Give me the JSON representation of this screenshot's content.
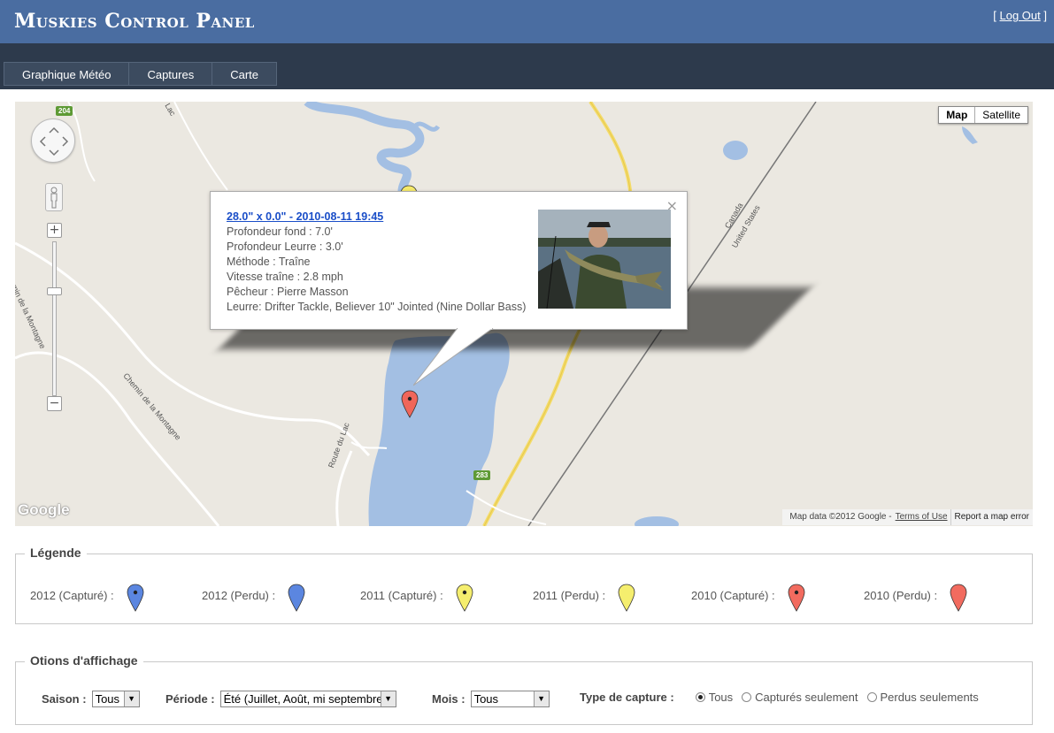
{
  "header": {
    "title": "Muskies Control Panel",
    "logout_prefix": "[ ",
    "logout_label": "Log Out",
    "logout_suffix": " ]"
  },
  "nav": {
    "tabs": [
      {
        "label": "Graphique Météo"
      },
      {
        "label": "Captures"
      },
      {
        "label": "Carte"
      }
    ]
  },
  "map": {
    "type_buttons": [
      "Map",
      "Satellite"
    ],
    "active_type": "Map",
    "logo": "Google",
    "footer": {
      "data_text": "Map data ©2012 Google -",
      "terms": "Terms of Use",
      "report": "Report a map error"
    },
    "road_shields": [
      "204",
      "283"
    ],
    "labels": {
      "chemin1": "Chemin de la Montagne",
      "chemin2": "Chemin de la Montagne",
      "route": "Route du Lac",
      "canada": "Canada",
      "us": "United States",
      "lac": "Lac"
    },
    "info_window": {
      "title": "28.0\" x 0.0\" - 2010-08-11 19:45",
      "lines": [
        "Profondeur fond : 7.0'",
        "Profondeur Leurre : 3.0'",
        "Méthode : Traîne",
        "Vitesse traîne : 2.8 mph",
        "Pêcheur : Pierre Masson",
        "Leurre: Drifter Tackle, Believer 10\" Jointed (Nine Dollar Bass)"
      ],
      "close": "×"
    },
    "markers": [
      {
        "year": "2011",
        "status": "Capturé",
        "color": "#f5e96a"
      },
      {
        "year": "2010",
        "status": "Capturé",
        "color": "#f0665a"
      }
    ]
  },
  "legend": {
    "title": "Légende",
    "items": [
      {
        "label": "2012 (Capturé) :",
        "color": "#5b86e0",
        "dot": true
      },
      {
        "label": "2012 (Perdu) :",
        "color": "#5b86e0",
        "dot": false
      },
      {
        "label": "2011 (Capturé) :",
        "color": "#f5ee6e",
        "dot": true
      },
      {
        "label": "2011 (Perdu) :",
        "color": "#f5ee6e",
        "dot": false
      },
      {
        "label": "2010 (Capturé) :",
        "color": "#f26b5f",
        "dot": true
      },
      {
        "label": "2010 (Perdu) :",
        "color": "#f26b5f",
        "dot": false
      }
    ]
  },
  "options": {
    "title": "Otions d'affichage",
    "saison": {
      "label": "Saison :",
      "value": "Tous"
    },
    "periode": {
      "label": "Période :",
      "value": "Été (Juillet, Août, mi septembre)"
    },
    "mois": {
      "label": "Mois :",
      "value": "Tous"
    },
    "type_capture": {
      "label": "Type de capture :",
      "options": [
        "Tous",
        "Capturés seulement",
        "Perdus seulements"
      ],
      "selected": "Tous"
    }
  }
}
